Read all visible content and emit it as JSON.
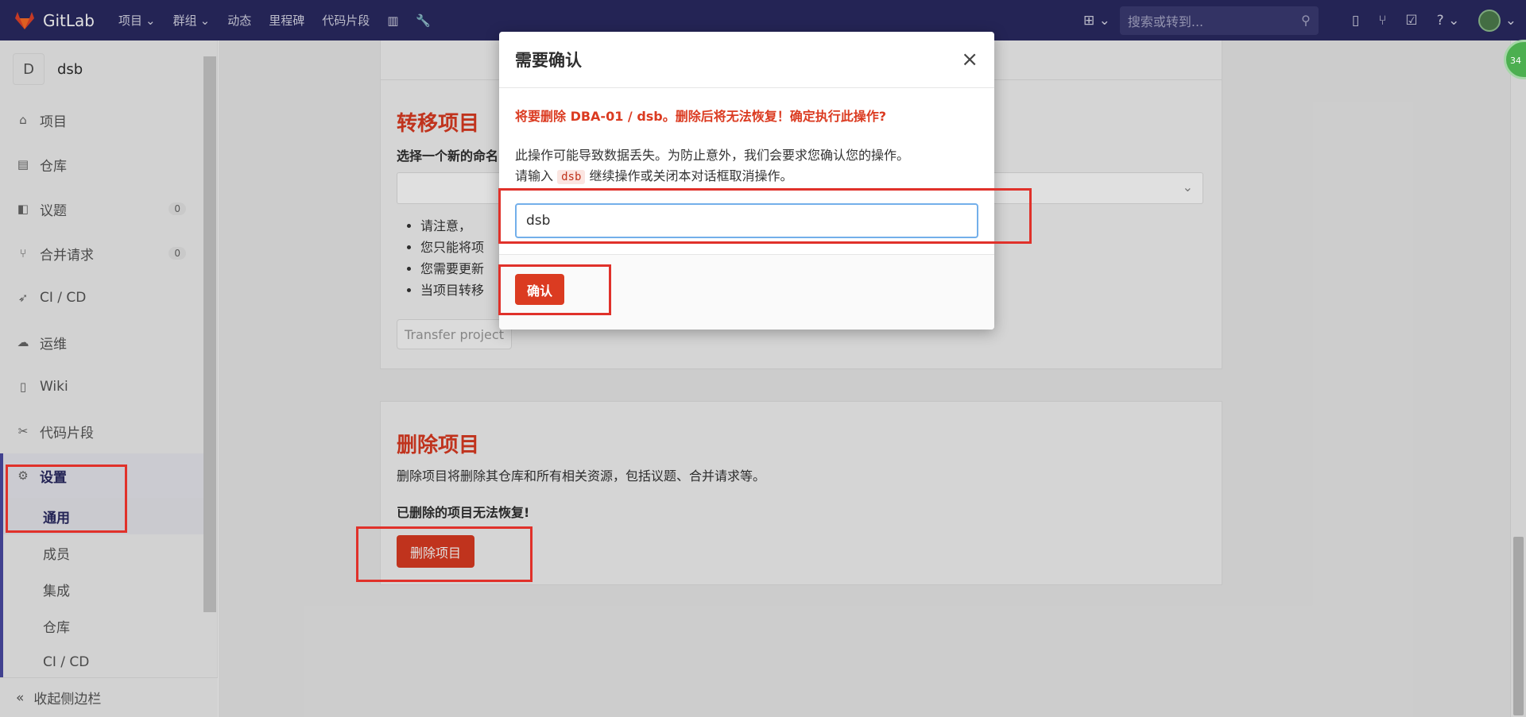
{
  "navbar": {
    "brand": "GitLab",
    "links": [
      "项目",
      "群组",
      "动态",
      "里程碑",
      "代码片段"
    ],
    "search_placeholder": "搜索或转到..."
  },
  "sidebar": {
    "project_initial": "D",
    "project_name": "dsb",
    "items": [
      {
        "label": "项目",
        "icon": "home-icon"
      },
      {
        "label": "仓库",
        "icon": "doc-icon"
      },
      {
        "label": "议题",
        "icon": "issues-icon",
        "count": "0"
      },
      {
        "label": "合并请求",
        "icon": "merge-request-icon",
        "count": "0"
      },
      {
        "label": "CI / CD",
        "icon": "rocket-icon"
      },
      {
        "label": "运维",
        "icon": "cloud-gear-icon"
      },
      {
        "label": "Wiki",
        "icon": "book-icon"
      },
      {
        "label": "代码片段",
        "icon": "scissors-icon"
      },
      {
        "label": "设置",
        "icon": "gear-icon"
      }
    ],
    "sub_items": [
      "通用",
      "成员",
      "集成",
      "仓库",
      "CI / CD"
    ],
    "collapse_label": "收起侧边栏"
  },
  "transfer": {
    "title": "转移项目",
    "subtitle": "选择一个新的命名",
    "notes": [
      "请注意，",
      "您只能将项",
      "您需要更新",
      "当项目转移"
    ],
    "button": "Transfer project"
  },
  "delete": {
    "title": "删除项目",
    "description": "删除项目将删除其仓库和所有相关资源，包括议题、合并请求等。",
    "warning": "已删除的项目无法恢复!",
    "button": "删除项目"
  },
  "modal": {
    "title": "需要确认",
    "close": "×",
    "warning": "将要删除 DBA-01 / dsb。删除后将无法恢复！确定执行此操作?",
    "desc_line1": "此操作可能导致数据丢失。为防止意外，我们会要求您确认您的操作。",
    "desc_prefix": "请输入",
    "desc_code": "dsb",
    "desc_suffix": "继续操作或关闭本对话框取消操作。",
    "input_value": "dsb",
    "confirm_button": "确认"
  },
  "badge": "34"
}
